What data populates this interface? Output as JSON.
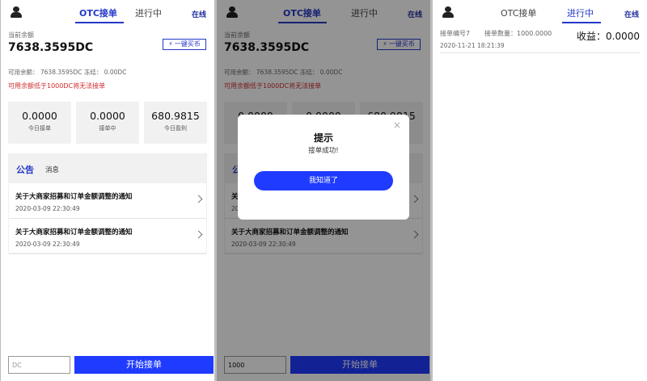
{
  "header": {
    "tab_otc": "OTC接单",
    "tab_progress": "进行中",
    "online": "在线"
  },
  "balance": {
    "label": "当前余额",
    "value": "7638.3595DC",
    "buy_button": "一键买币",
    "available_text": "可用余额：  7638.3595DC      冻结：  0.00DC",
    "warning": "可用余额低于1000DC将无法接单"
  },
  "stats": [
    {
      "value": "0.0000",
      "label": "今日接单"
    },
    {
      "value": "0.0000",
      "label": "接单中"
    },
    {
      "value": "680.9815",
      "label": "今日盈利"
    }
  ],
  "news": {
    "tab_notice": "公告",
    "tab_message": "消息",
    "items": [
      {
        "title": "关于大商家招募和订单金额调整的通知",
        "date": "2020-03-09 22:30:49"
      },
      {
        "title": "关于大商家招募和订单金额调整的通知",
        "date": "2020-03-09 22:30:49"
      }
    ]
  },
  "footer": {
    "input_placeholder": "DC",
    "input_value_screen2": "1000",
    "start_button": "开始接单"
  },
  "modal": {
    "title": "提示",
    "message": "接单成功!",
    "ok_button": "我知道了",
    "close": "×"
  },
  "order": {
    "order_no": "接单编号7",
    "quantity": "接单数量：1000.0000",
    "time": "2020-11-21 18:21:39",
    "profit": "收益：0.0000"
  },
  "colors": {
    "accent": "#2438c8",
    "button": "#1f3bff",
    "warning": "#d0282e"
  }
}
